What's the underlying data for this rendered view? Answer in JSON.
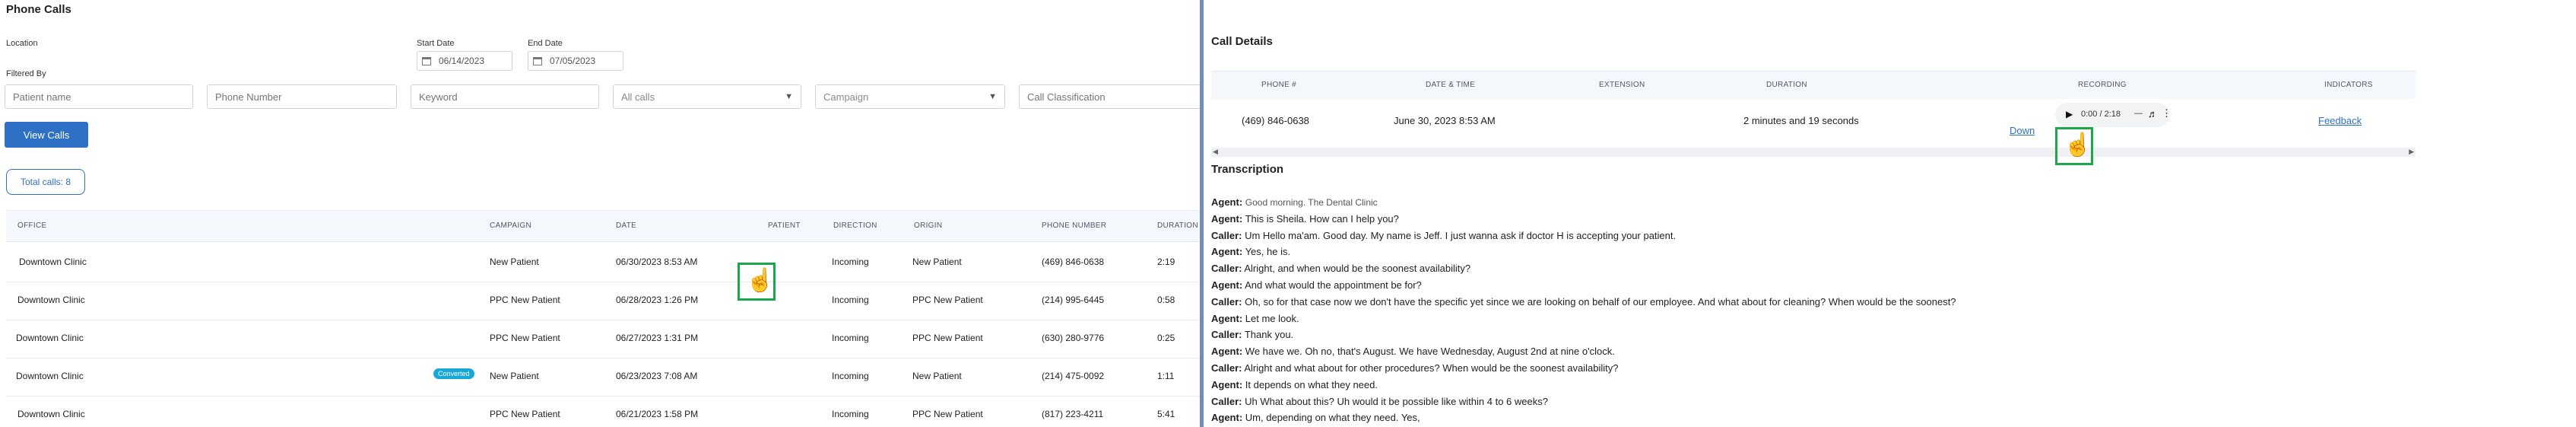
{
  "left": {
    "title": "Phone Calls",
    "filters": {
      "location_label": "Location",
      "start_date_label": "Start Date",
      "start_date": "06/14/2023",
      "end_date_label": "End Date",
      "end_date": "07/05/2023",
      "filtered_by_label": "Filtered By",
      "patient_name_placeholder": "Patient name",
      "phone_number_placeholder": "Phone Number",
      "keyword_placeholder": "Keyword",
      "calls_select": "All calls",
      "campaign_select": "Campaign",
      "classification_placeholder": "Call Classification"
    },
    "view_calls_label": "View Calls",
    "total_calls": "Total calls: 8",
    "table": {
      "headers": [
        "OFFICE",
        "CAMPAIGN",
        "DATE",
        "PATIENT",
        "DIRECTION",
        "ORIGIN",
        "PHONE NUMBER",
        "DURATION"
      ],
      "rows": [
        {
          "office": "Downtown Clinic",
          "badge": "",
          "campaign": "New Patient",
          "date": "06/30/2023 8:53 AM",
          "patient": "",
          "direction": "Incoming",
          "origin": "New Patient",
          "phone": "(469) 846-0638",
          "duration": "2:19"
        },
        {
          "office": "Downtown Clinic",
          "badge": "",
          "campaign": "PPC New Patient",
          "date": "06/28/2023 1:26 PM",
          "patient": "",
          "direction": "Incoming",
          "origin": "PPC New Patient",
          "phone": "(214) 995-6445",
          "duration": "0:58"
        },
        {
          "office": "Downtown Clinic",
          "badge": "",
          "campaign": "PPC New Patient",
          "date": "06/27/2023 1:31 PM",
          "patient": "",
          "direction": "Incoming",
          "origin": "PPC New Patient",
          "phone": "(630) 280-9776",
          "duration": "0:25"
        },
        {
          "office": "Downtown Clinic",
          "badge": "Converted",
          "campaign": "New Patient",
          "date": "06/23/2023 7:08 AM",
          "patient": "",
          "direction": "Incoming",
          "origin": "New Patient",
          "phone": "(214) 475-0092",
          "duration": "1:11"
        },
        {
          "office": "Downtown Clinic",
          "badge": "",
          "campaign": "PPC New Patient",
          "date": "06/21/2023 1:58 PM",
          "patient": "",
          "direction": "Incoming",
          "origin": "PPC New Patient",
          "phone": "(817) 223-4211",
          "duration": "5:41"
        }
      ]
    }
  },
  "right": {
    "title": "Call Details",
    "table": {
      "headers": [
        "PHONE #",
        "DATE & TIME",
        "EXTENSION",
        "DURATION",
        "RECORDING",
        "INDICATORS"
      ],
      "row": {
        "phone": "(469) 846-0638",
        "datetime": "June 30, 2023 8:53 AM",
        "extension": "",
        "duration": "2 minutes and 19 seconds",
        "recording_time": "0:00 / 2:18",
        "download_label": "Down",
        "feedback_label": "Feedback"
      }
    },
    "transcription_title": "Transcription",
    "transcript": [
      {
        "speaker": "Agent:",
        "text": "Good morning. The Dental Clinic"
      },
      {
        "speaker": "Agent:",
        "text": "This is Sheila. How can I help you?"
      },
      {
        "speaker": "Caller:",
        "text": "Um Hello ma'am. Good day. My name is Jeff. I just wanna ask if doctor H is accepting your patient."
      },
      {
        "speaker": "Agent:",
        "text": "Yes, he is."
      },
      {
        "speaker": "Caller:",
        "text": "Alright, and when would be the soonest availability?"
      },
      {
        "speaker": "Agent:",
        "text": "And what would the appointment be for?"
      },
      {
        "speaker": "Caller:",
        "text": "Oh, so for that case now we don't have the specific yet since we are looking on behalf of our employee. And what about for cleaning? When would be the soonest?"
      },
      {
        "speaker": "Agent:",
        "text": "Let me look."
      },
      {
        "speaker": "Caller:",
        "text": "Thank you."
      },
      {
        "speaker": "Agent:",
        "text": "We have we. Oh no, that's August. We have Wednesday, August 2nd at nine o'clock."
      },
      {
        "speaker": "Caller:",
        "text": "Alright and what about for other procedures? When would be the soonest availability?"
      },
      {
        "speaker": "Agent:",
        "text": "It depends on what they need."
      },
      {
        "speaker": "Caller:",
        "text": "Uh What about this? Uh would it be possible like within 4 to 6 weeks?"
      },
      {
        "speaker": "Agent:",
        "text": "Um, depending on what they need. Yes,"
      }
    ]
  },
  "icons": {
    "calendar": "calendar-icon",
    "chevron": "chevron-down-icon",
    "cursor": "hand-pointer-icon",
    "play": "play-icon",
    "volume": "volume-icon",
    "more": "more-vert-icon"
  },
  "colors": {
    "primary": "#2e70c6",
    "converted_badge": "#18a8d8",
    "highlight": "#1aa84a",
    "divider": "#6f8fb8"
  }
}
